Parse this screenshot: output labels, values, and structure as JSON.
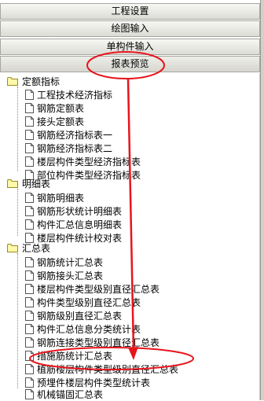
{
  "nav": {
    "engineering_settings": "工程设置",
    "drawing_input": "绘图输入",
    "single_component_input": "单构件输入",
    "report_preview": "报表预览"
  },
  "tree": {
    "groups": [
      {
        "label": "定额指标",
        "items": [
          "工程技术经济指标",
          "钢筋定额表",
          "接头定额表",
          "钢筋经济指标表一",
          "钢筋经济指标表二",
          "楼层构件类型经济指标表",
          "部位构件类型经济指标表"
        ]
      },
      {
        "label": "明细表",
        "items": [
          "钢筋明细表",
          "钢筋形状统计明细表",
          "构件汇总信息明细表",
          "楼层构件统计校对表"
        ]
      },
      {
        "label": "汇总表",
        "items": [
          "钢筋统计汇总表",
          "钢筋接头汇总表",
          "楼层构件类型级别直径汇总表",
          "构件类型级别直径汇总表",
          "钢筋级别直径汇总表",
          "构件汇总信息分类统计表",
          "钢筋连接类型级别直径汇总表",
          "措施筋统计汇总表",
          "植筋楼层构件类型级别直径汇总表",
          "预埋件楼层构件类型统计表",
          "机械锚固汇总表"
        ]
      }
    ]
  },
  "annotation_color": "#e8141b"
}
